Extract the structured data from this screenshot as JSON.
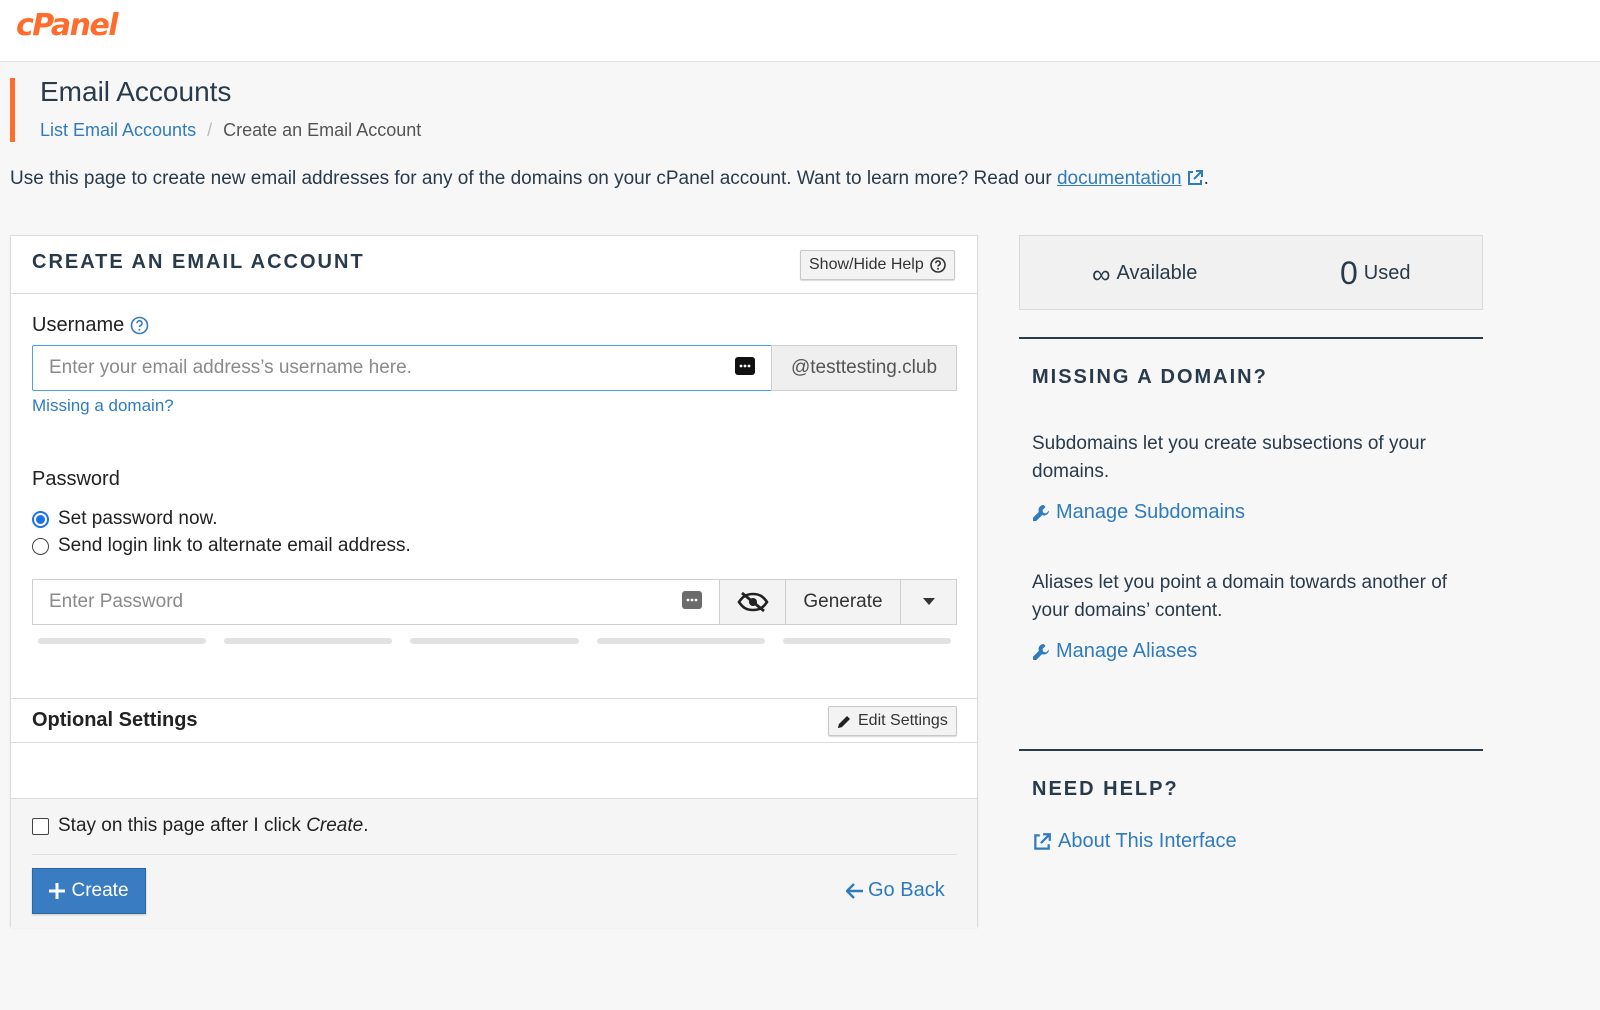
{
  "brand": {
    "logo_text": "cPanel",
    "accent_color": "#ff6c2c",
    "link_color": "#2f7bbf"
  },
  "header": {
    "title": "Email Accounts",
    "breadcrumb": {
      "parent": "List Email Accounts",
      "separator": "/",
      "current": "Create an Email Account"
    }
  },
  "intro": {
    "text": "Use this page to create new email addresses for any of the domains on your cPanel account. Want to learn more? Read our ",
    "link": "documentation",
    "suffix": "."
  },
  "form": {
    "title": "CREATE AN EMAIL ACCOUNT",
    "help_button": "Show/Hide Help",
    "username": {
      "label": "Username",
      "placeholder": "Enter your email address’s username here.",
      "value": "",
      "domain": "@testtesting.club",
      "missing_link": "Missing a domain?"
    },
    "password": {
      "label": "Password",
      "options": [
        {
          "label": "Set password now.",
          "checked": true
        },
        {
          "label": "Send login link to alternate email address.",
          "checked": false
        }
      ],
      "placeholder": "Enter Password",
      "value": "",
      "generate_label": "Generate",
      "strength_segments": 5,
      "strength_level": 0
    },
    "optional": {
      "title": "Optional Settings",
      "edit_button": "Edit Settings"
    },
    "footer": {
      "stay_text": "Stay on this page after I click ",
      "stay_emphasis": "Create",
      "stay_suffix": ".",
      "stay_checked": false,
      "create_label": "Create",
      "go_back_label": "Go Back"
    }
  },
  "stats": {
    "available_symbol": "∞",
    "available_label": "Available",
    "used_count": "0",
    "used_label": "Used"
  },
  "sidebar": {
    "missing_domain": {
      "heading": "MISSING A DOMAIN?",
      "subdomains_text": "Subdomains let you create subsections of your domains.",
      "subdomains_link": "Manage Subdomains",
      "aliases_text": "Aliases let you point a domain towards another of your domains’ content.",
      "aliases_link": "Manage Aliases"
    },
    "need_help": {
      "heading": "NEED HELP?",
      "link": "About This Interface"
    }
  },
  "icons": {
    "help": "question-circle-icon",
    "keyboard": "password-manager-icon",
    "eye": "eye-slash-icon",
    "caret": "caret-down-icon",
    "pencil": "pencil-icon",
    "plus": "plus-icon",
    "back": "arrow-left-icon",
    "wrench": "wrench-icon",
    "external": "external-link-icon"
  }
}
